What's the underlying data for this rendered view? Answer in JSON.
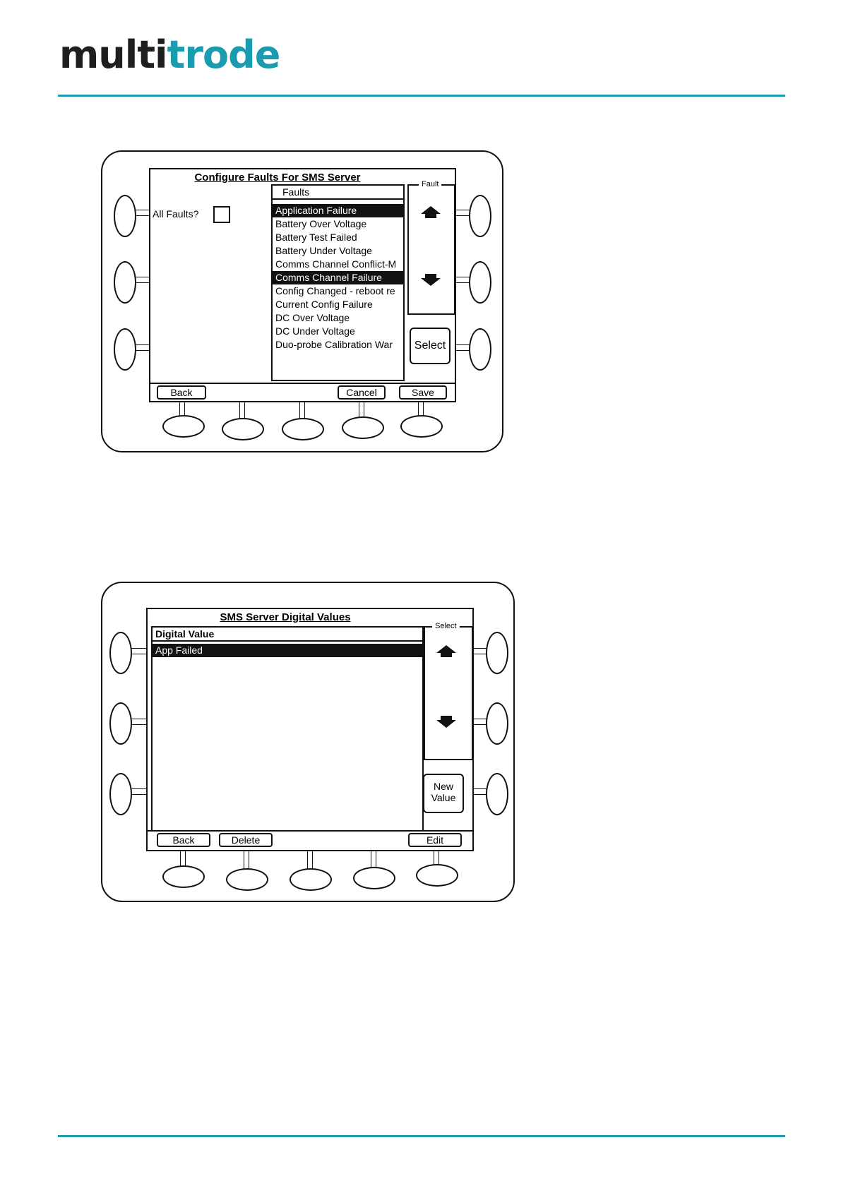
{
  "brand": {
    "logo_dark": "multi",
    "logo_teal": "trode",
    "accent_color": "#1a9bb0"
  },
  "screen1": {
    "title": "Configure Faults For SMS Server",
    "all_faults_label": "All Faults?",
    "list_header": "Faults",
    "faults": [
      {
        "label": "Application Failure",
        "selected": true
      },
      {
        "label": "Battery Over Voltage",
        "selected": false
      },
      {
        "label": "Battery Test Failed",
        "selected": false
      },
      {
        "label": "Battery Under Voltage",
        "selected": false
      },
      {
        "label": "Comms Channel Conflict-M",
        "selected": false
      },
      {
        "label": "Comms Channel Failure",
        "selected": true
      },
      {
        "label": "Config Changed - reboot re",
        "selected": false
      },
      {
        "label": "Current Config Failure",
        "selected": false
      },
      {
        "label": "DC Over Voltage",
        "selected": false
      },
      {
        "label": "DC Under Voltage",
        "selected": false
      },
      {
        "label": "Duo-probe Calibration War",
        "selected": false
      }
    ],
    "scroll_panel_label": "Fault",
    "select_button": "Select",
    "softkeys": {
      "back": "Back",
      "cancel": "Cancel",
      "save": "Save"
    }
  },
  "screen2": {
    "title": "SMS Server Digital Values",
    "list_header": "Digital Value",
    "values": [
      {
        "label": "App Failed",
        "selected": true
      }
    ],
    "scroll_panel_label": "Select",
    "new_value_line1": "New",
    "new_value_line2": "Value",
    "softkeys": {
      "back": "Back",
      "delete": "Delete",
      "edit": "Edit"
    }
  }
}
